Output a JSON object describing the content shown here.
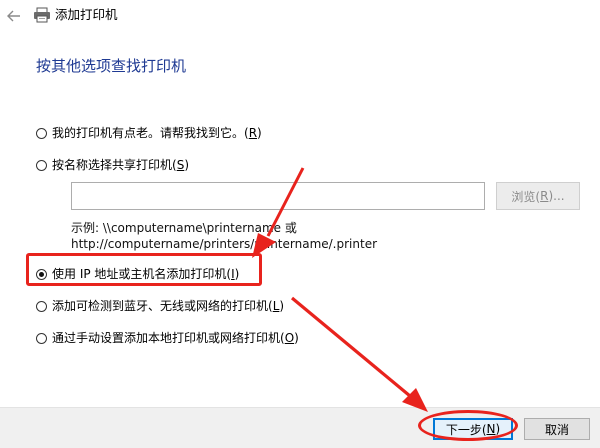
{
  "window": {
    "title": "添加打印机",
    "icon": "printer-icon",
    "back_icon": "back-arrow-icon"
  },
  "heading": "按其他选项查找打印机",
  "options": [
    {
      "label": "我的打印机有点老。请帮我找到它。(",
      "mnemonic": "R",
      "suffix": ")",
      "checked": false
    },
    {
      "label": "按名称选择共享打印机(",
      "mnemonic": "S",
      "suffix": ")",
      "checked": false
    },
    {
      "label": "使用 IP 地址或主机名添加打印机(",
      "mnemonic": "I",
      "suffix": ")",
      "checked": true
    },
    {
      "label": "添加可检测到蓝牙、无线或网络的打印机(",
      "mnemonic": "L",
      "suffix": ")",
      "checked": false
    },
    {
      "label": "通过手动设置添加本地打印机或网络打印机(",
      "mnemonic": "O",
      "suffix": ")",
      "checked": false
    }
  ],
  "shared_printer": {
    "input_value": "",
    "browse_label": "浏览(",
    "browse_mnemonic": "R",
    "browse_suffix": ")...",
    "example_line1": "示例: \\\\computername\\printername 或",
    "example_line2": "http://computername/printers/printername/.printer"
  },
  "footer": {
    "next_label": "下一步(",
    "next_mnemonic": "N",
    "next_suffix": ")",
    "cancel_label": "取消"
  },
  "colors": {
    "heading": "#1f3a93",
    "annotation": "#e8231d",
    "default_button_border": "#0078d7",
    "footer_background": "#f0f0f0"
  }
}
